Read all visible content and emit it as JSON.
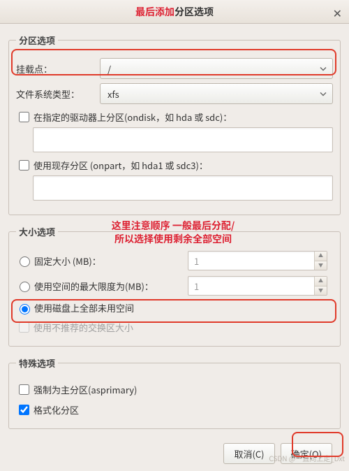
{
  "title": {
    "prefix": "最后添加",
    "rest": "分区选项"
  },
  "sections": {
    "partition": {
      "legend": "分区选项",
      "mount_label": "挂载点：",
      "mount_value": "/",
      "fs_label": "文件系统类型：",
      "fs_value": "xfs",
      "ondisk_label": "在指定的驱动器上分区(ondisk，如 hda 或 sdc)：",
      "onpart_label": "使用现存分区 (onpart，如 hda1 或 sdc3)："
    },
    "size": {
      "legend": "大小选项",
      "fixed_label": "固定大小 (MB)：",
      "fixed_value": "1",
      "max_label": "使用空间的最大限度为(MB)：",
      "max_value": "1",
      "fill_label": "使用磁盘上全部未用空间",
      "swap_label": "使用不推荐的交换区大小"
    },
    "extra": {
      "legend": "特殊选项",
      "asprimary_label": "强制为主分区(asprimary)",
      "format_label": "格式化分区"
    }
  },
  "annotation": {
    "line1": "这里注意顺序 一般最后分配/",
    "line2": "所以选择使用剩余全部空间"
  },
  "buttons": {
    "cancel": "取消(C)",
    "ok": "确定(O)"
  },
  "watermark": "CSDN @一直向上走_Dxt"
}
